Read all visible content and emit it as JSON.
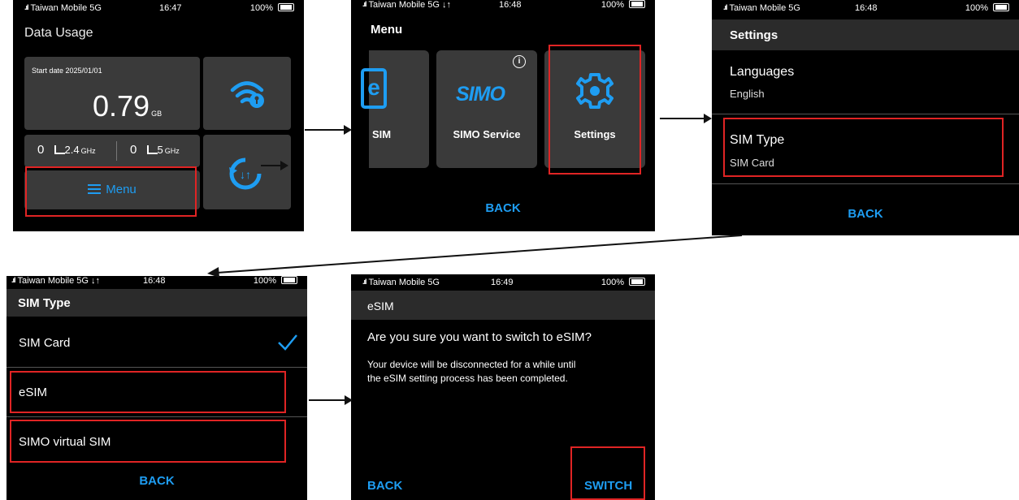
{
  "status": {
    "carrier": "Taiwan Mobile 5G",
    "battery": "100%",
    "time_s1": "16:47",
    "time_s2": "16:48",
    "time_s3": "16:48",
    "time_s4": "16:48",
    "time_s5": "16:49"
  },
  "screen1": {
    "title": "Data Usage",
    "start_date": "Start date 2025/01/01",
    "usage_value": "0.79",
    "usage_unit": "GB",
    "count_24": "0",
    "band_24": "2.4",
    "band_24_unit": "GHz",
    "count_5": "0",
    "band_5": "5",
    "band_5_unit": "GHz",
    "menu_label": "Menu"
  },
  "screen2": {
    "title": "Menu",
    "item_esim": "SIM",
    "item_simo": "SIMO Service",
    "item_settings": "Settings",
    "simo_logo": "SIMO",
    "info_glyph": "i",
    "back": "BACK"
  },
  "screen3": {
    "title": "Settings",
    "languages_label": "Languages",
    "languages_value": "English",
    "simtype_label": "SIM Type",
    "simtype_value": "SIM Card",
    "back": "BACK"
  },
  "screen4": {
    "title": "SIM Type",
    "options": [
      "SIM Card",
      "eSIM",
      "SIMO virtual SIM"
    ],
    "back": "BACK"
  },
  "screen5": {
    "title": "eSIM",
    "question": "Are you sure you want to switch to eSIM?",
    "message_line1": "Your device will be disconnected for a while until",
    "message_line2": "the eSIM setting process has been completed.",
    "back": "BACK",
    "switch": "SWITCH"
  },
  "colors": {
    "accent": "#1e9df2",
    "highlight": "#e02424",
    "tile": "#3a3a3a",
    "titlebar": "#2b2b2b"
  },
  "icons": [
    "signal-icon",
    "battery-icon",
    "wifi-key-icon",
    "sync-icon",
    "hamburger-icon",
    "monitor-icon",
    "gear-icon",
    "checkmark-icon",
    "info-icon",
    "esim-icon",
    "simo-logo-icon"
  ]
}
